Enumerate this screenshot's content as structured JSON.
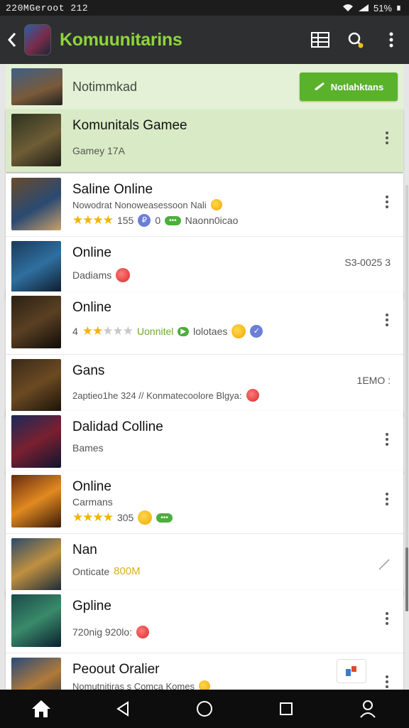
{
  "status_bar": {
    "time_text": "220MGeroot 212",
    "battery_text": "51%"
  },
  "app_bar": {
    "title": "Komuunitarins"
  },
  "banner": {
    "label": "Notimmkad",
    "cta_label": "Notlahktans"
  },
  "items": [
    {
      "title": "Komunitals Gamee",
      "subtitle": "Gamey  17A"
    },
    {
      "title": "Saline Online",
      "line1": "Nowodrat Nonoweasessoon Nali",
      "rating_count": "155",
      "badge_count": "0",
      "tag": "Naonn0icao"
    },
    {
      "title": "Online",
      "subtitle": "Dadiams",
      "meta": "S3-0025 3"
    },
    {
      "title": "Online",
      "rating_prefix": "4",
      "green_text": "Uonnitel",
      "extra": "lolotaes"
    },
    {
      "title": "Gans",
      "subtitle": "2aptieo1he 324 // Konmatecoolore Blgya:",
      "meta": "1EMO :"
    },
    {
      "title": "Dalidad Colline",
      "subtitle": "Bames"
    },
    {
      "title": "Online",
      "subtitle": "Carmans",
      "rating_count": "305"
    },
    {
      "title": "Nan",
      "subtitle": "Onticate",
      "gold_text": "800M"
    },
    {
      "title": "Gpline",
      "subtitle": "720nig  920lo:"
    },
    {
      "title": "Peoout Oralier",
      "subtitle": "Nomutnitiras s Comca Komes"
    }
  ],
  "colors": {
    "accent": "#8fd53b",
    "cta": "#5ab22b",
    "highlight": "#d9ebc6"
  },
  "icons": {
    "nav": [
      "home-icon",
      "back-triangle-icon",
      "home-circle-icon",
      "recents-square-icon",
      "account-icon"
    ]
  }
}
